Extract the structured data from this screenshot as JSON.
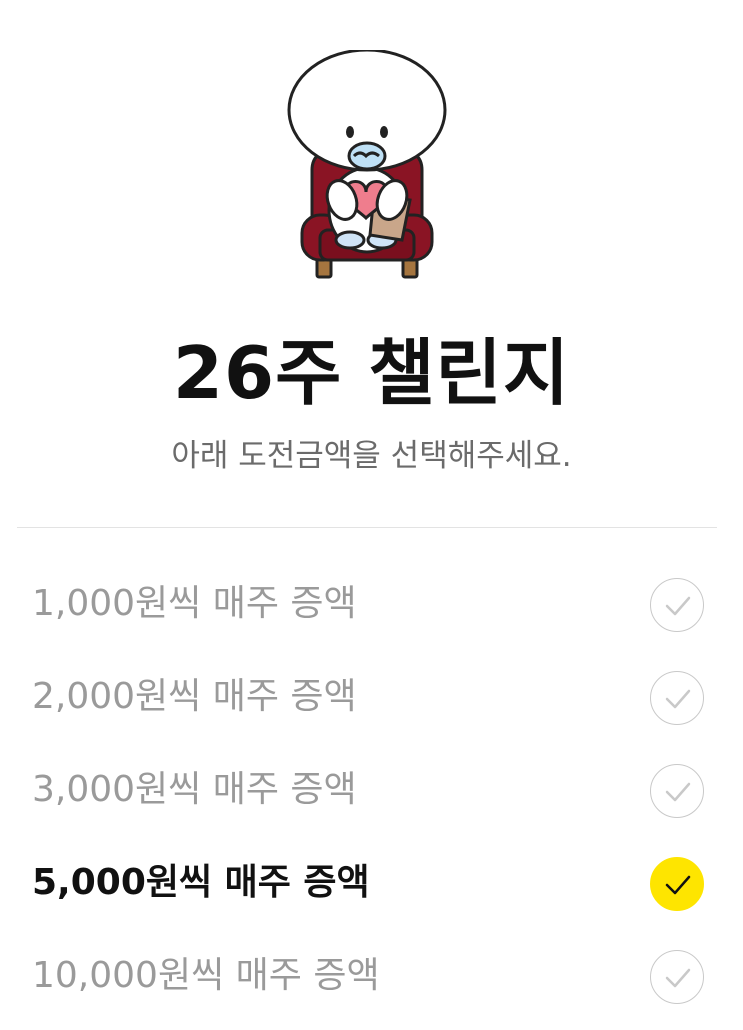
{
  "header": {
    "title": "26주 챌린지",
    "subtitle": "아래 도전금액을 선택해주세요."
  },
  "options": [
    {
      "label": "1,000원씩 매주 증액",
      "selected": false
    },
    {
      "label": "2,000원씩 매주 증액",
      "selected": false
    },
    {
      "label": "3,000원씩 매주 증액",
      "selected": false
    },
    {
      "label": "5,000원씩 매주 증액",
      "selected": true
    },
    {
      "label": "10,000원씩 매주 증액",
      "selected": false
    }
  ],
  "colors": {
    "accent": "#fee500",
    "selected_text": "#111111",
    "unselected_text": "#9a9a9a",
    "subtitle_text": "#6b6b6b"
  },
  "icons": {
    "mascot": "mascot-character-illustration",
    "check": "check-icon"
  }
}
